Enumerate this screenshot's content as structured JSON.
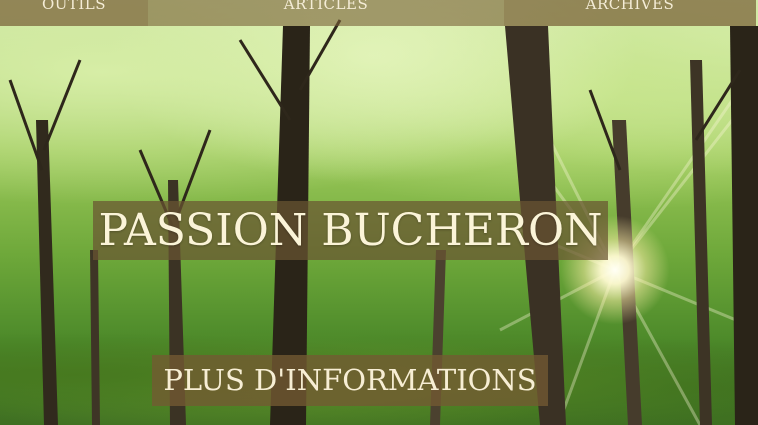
{
  "nav": {
    "items": [
      {
        "label": "OUTILS"
      },
      {
        "label": "ARTICLES"
      },
      {
        "label": "ARCHIVES"
      }
    ]
  },
  "hero": {
    "title": "PASSION BUCHERON",
    "button_label": "PLUS D'INFORMATIONS"
  },
  "colors": {
    "overlay": "#73593A",
    "text": "#FBF4D8"
  }
}
